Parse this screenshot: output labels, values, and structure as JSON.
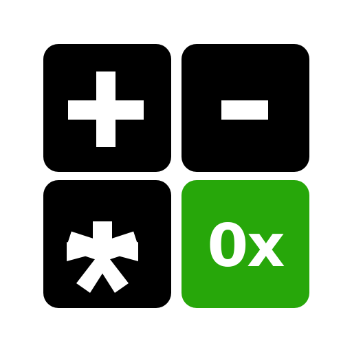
{
  "colors": {
    "tile_dark": "#000000",
    "tile_accent": "#27a70a",
    "glyph": "#ffffff",
    "background": "#ffffff"
  },
  "tiles": [
    {
      "id": "plus",
      "icon": "plus-icon"
    },
    {
      "id": "minus",
      "icon": "minus-icon"
    },
    {
      "id": "multiply",
      "icon": "asterisk-icon"
    },
    {
      "id": "hex",
      "label": "0x"
    }
  ]
}
